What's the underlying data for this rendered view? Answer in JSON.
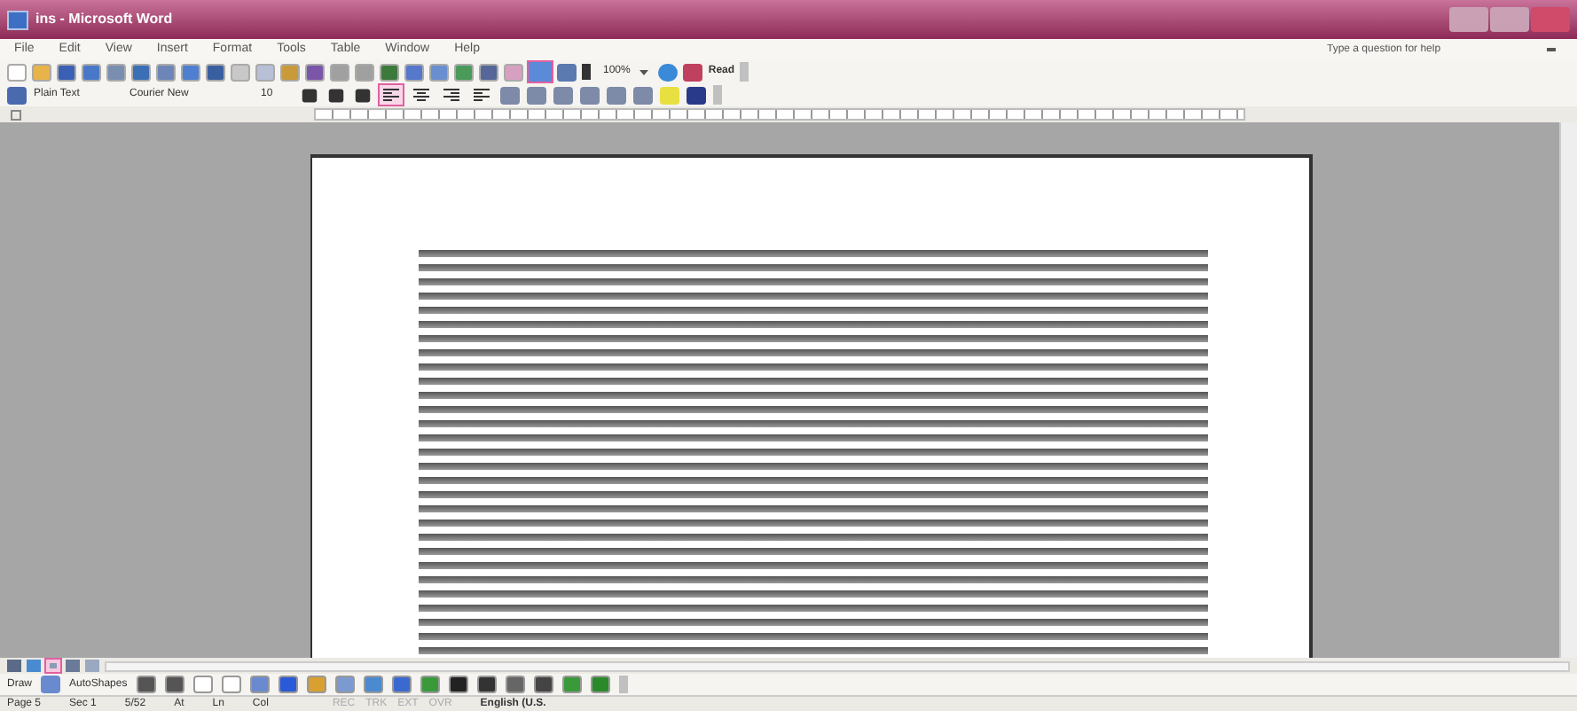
{
  "window": {
    "title": "ins - Microsoft Word"
  },
  "menu": [
    "File",
    "Edit",
    "View",
    "Insert",
    "Format",
    "Tools",
    "Table",
    "Window",
    "Help"
  ],
  "help_box": {
    "placeholder": "Type a question for help"
  },
  "standard_toolbar": {
    "zoom": "100%",
    "read": "Read",
    "drawing_toggle": {
      "selected": true
    }
  },
  "formatting_toolbar": {
    "style": "Plain Text",
    "font": "Courier New",
    "size": "10",
    "align_buttons": [
      {
        "kind": "left",
        "selected": true
      },
      {
        "kind": "center",
        "selected": false
      },
      {
        "kind": "right",
        "selected": false
      },
      {
        "kind": "justify",
        "selected": false
      }
    ]
  },
  "view_buttons": [
    {
      "kind": "normal",
      "selected": false
    },
    {
      "kind": "web",
      "selected": false
    },
    {
      "kind": "print",
      "selected": true
    },
    {
      "kind": "outline",
      "selected": false
    },
    {
      "kind": "reading",
      "selected": false
    }
  ],
  "drawing_toolbar": {
    "draw": "Draw",
    "autoshapes": "AutoShapes"
  },
  "status_bar": {
    "page": "Page 5",
    "section": "Sec 1",
    "pages": "5/52",
    "at": "At",
    "line": "Ln",
    "column": "Col",
    "modes": [
      "REC",
      "TRK",
      "EXT",
      "OVR"
    ],
    "language": "English (U.S."
  }
}
